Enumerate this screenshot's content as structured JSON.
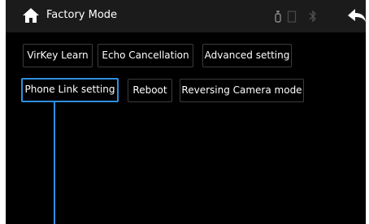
{
  "header": {
    "title": "Factory Mode",
    "icons": [
      "home-icon",
      "usb-icon",
      "battery-icon",
      "bluetooth-icon",
      "back-arrow-icon"
    ]
  },
  "menu": {
    "row1": [
      {
        "label": "VirKey Learn"
      },
      {
        "label": "Echo Cancellation"
      },
      {
        "label": "Advanced setting"
      }
    ],
    "row2": [
      {
        "label": "Phone Link setting",
        "selected": true
      },
      {
        "label": "Reboot"
      },
      {
        "label": "Reversing Camera mode"
      }
    ]
  },
  "colors": {
    "background": "#000000",
    "title_bar": "#1b1b1b",
    "accent": "#2f8fe0",
    "button_border": "#3c3c3c",
    "text": "#ffffff"
  }
}
